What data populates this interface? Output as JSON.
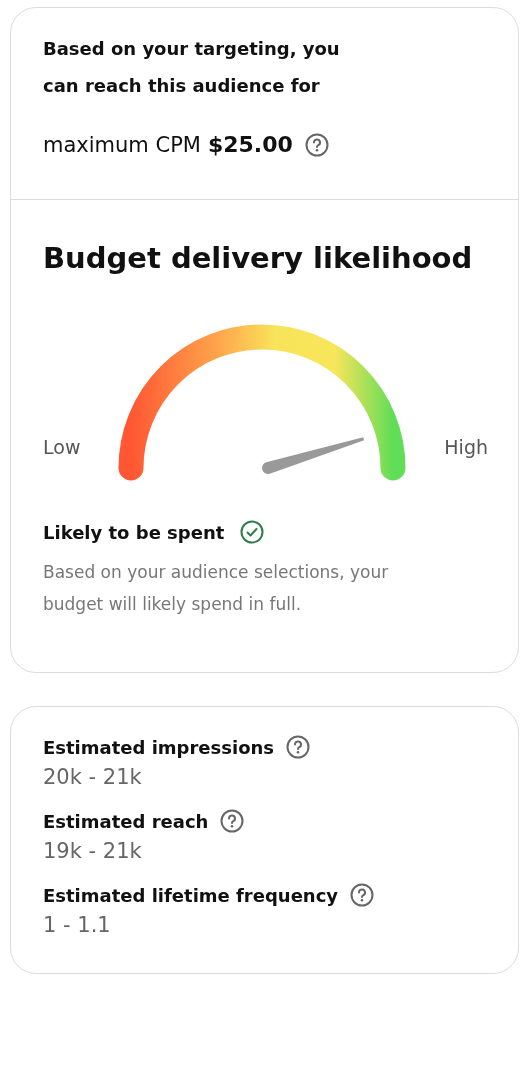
{
  "summary": {
    "text": "Based on your targeting, you can reach this audience for",
    "cpm_label": "maximum CPM",
    "cpm_value": "$25.00"
  },
  "likelihood": {
    "title": "Budget delivery likelihood",
    "low_label": "Low",
    "high_label": "High",
    "status": "Likely to be spent",
    "description": "Based on your audience selections, your budget will likely spend in full."
  },
  "estimates": [
    {
      "label": "Estimated impressions",
      "value": "20k - 21k"
    },
    {
      "label": "Estimated reach",
      "value": "19k - 21k"
    },
    {
      "label": "Estimated lifetime frequency",
      "value": "1 - 1.1"
    }
  ]
}
